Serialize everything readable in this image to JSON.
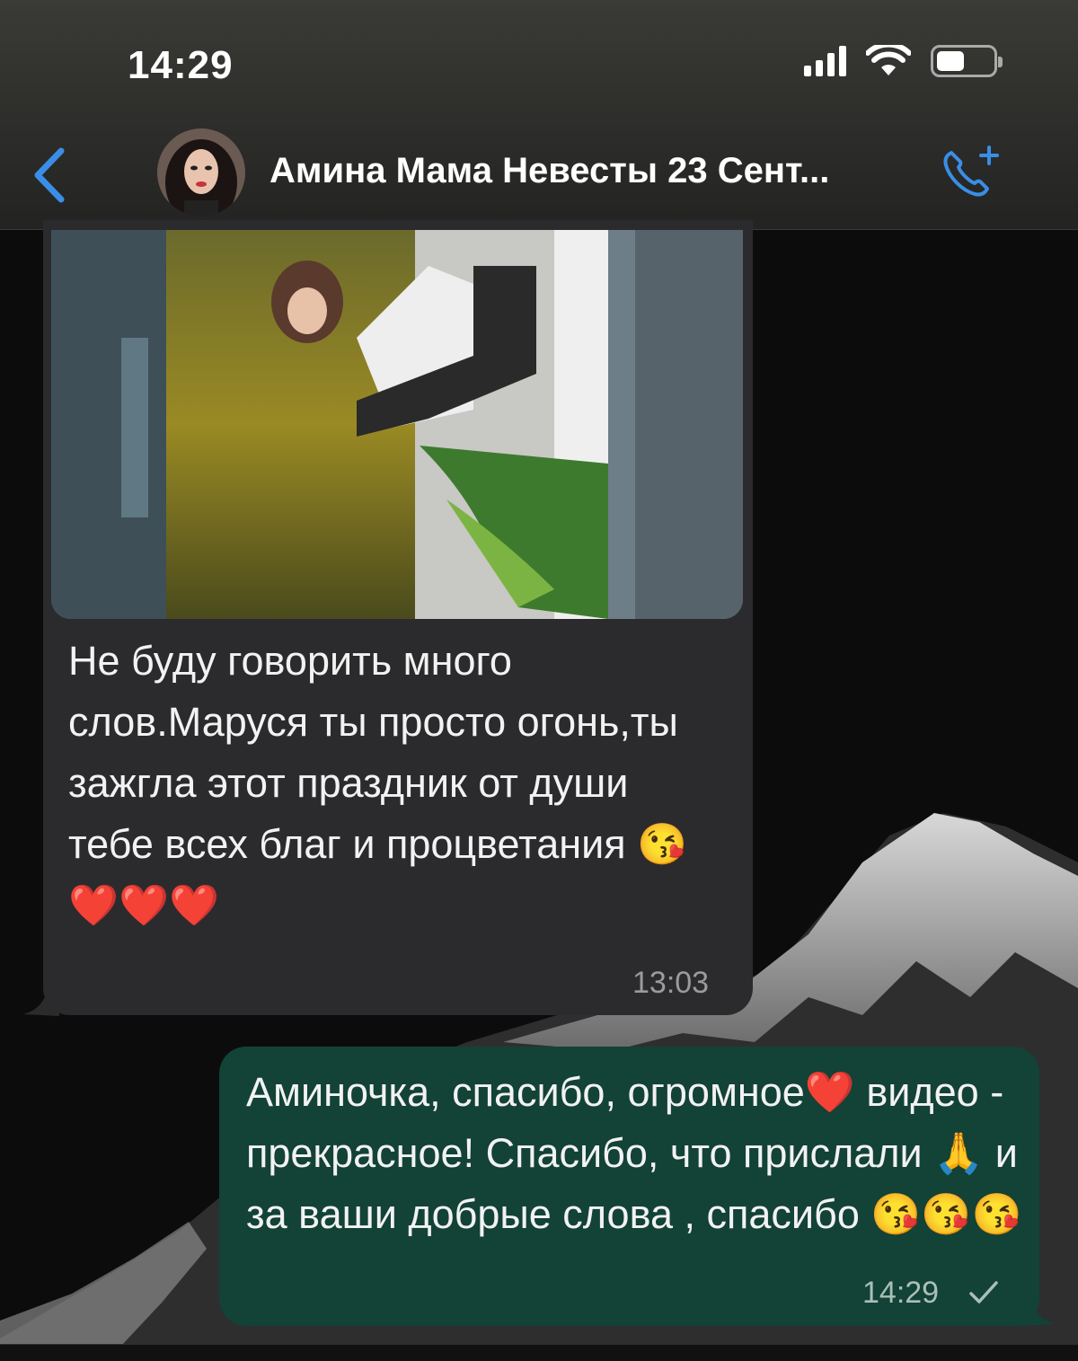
{
  "status_bar": {
    "time": "14:29"
  },
  "header": {
    "chat_title": "Амина Мама Невесты 23 Сент...",
    "back_icon": "chevron-left-icon",
    "call_icon": "add-call-icon",
    "accent_color": "#3a8ee6"
  },
  "messages": [
    {
      "direction": "incoming",
      "has_media": true,
      "text": "Не буду говорить много слов.Маруся ты просто огонь,ты зажгла этот праздник от души тебе всех благ и процветания",
      "emojis": [
        "😘",
        "❤️",
        "❤️",
        "❤️"
      ],
      "time": "13:03",
      "bubble_color": "#2b2b2d"
    },
    {
      "direction": "outgoing",
      "text_part1": "Аминочка, спасибо, огромное",
      "text_part2": "видео - прекрасное! Спасибо, что прислали",
      "text_part3": "и за ваши добрые слова , спасибо",
      "emojis": [
        "❤️",
        "🙏",
        "😘",
        "😘",
        "😘"
      ],
      "time": "14:29",
      "status_icon": "single-check-icon",
      "bubble_color": "#134236"
    }
  ]
}
